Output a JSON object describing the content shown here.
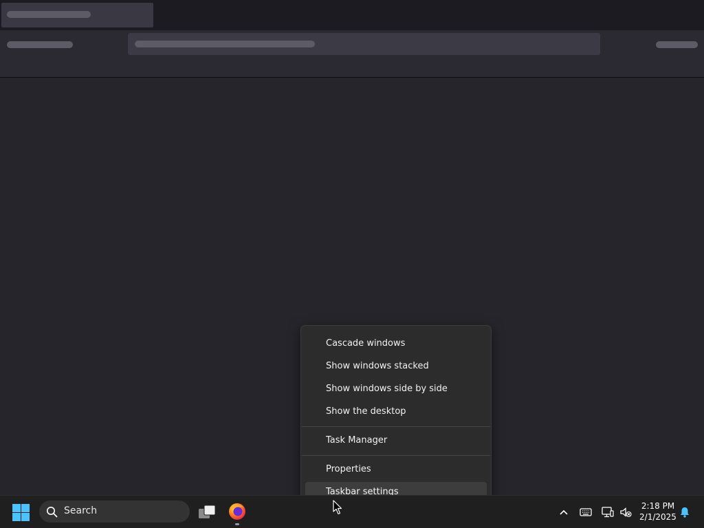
{
  "context_menu": {
    "items": [
      {
        "label": "Cascade windows"
      },
      {
        "label": "Show windows stacked"
      },
      {
        "label": "Show windows side by side"
      },
      {
        "label": "Show the desktop"
      },
      {
        "label": "Task Manager"
      },
      {
        "label": "Properties"
      },
      {
        "label": "Taskbar settings",
        "highlighted": true
      }
    ]
  },
  "taskbar": {
    "search_label": "Search",
    "clock": {
      "time": "2:18 PM",
      "date": "2/1/2025"
    },
    "icons": [
      "windows-start-icon",
      "search-icon",
      "task-view-icon",
      "firefox-icon",
      "chevron-up-icon",
      "keyboard-icon",
      "network-icon",
      "speaker-muted-icon",
      "notification-bell-icon"
    ]
  },
  "colors": {
    "accent": "#4cc2ff",
    "menu_background": "#2c2c2c",
    "taskbar_background": "#1f1f1f",
    "desktop_background": "#26252b"
  }
}
